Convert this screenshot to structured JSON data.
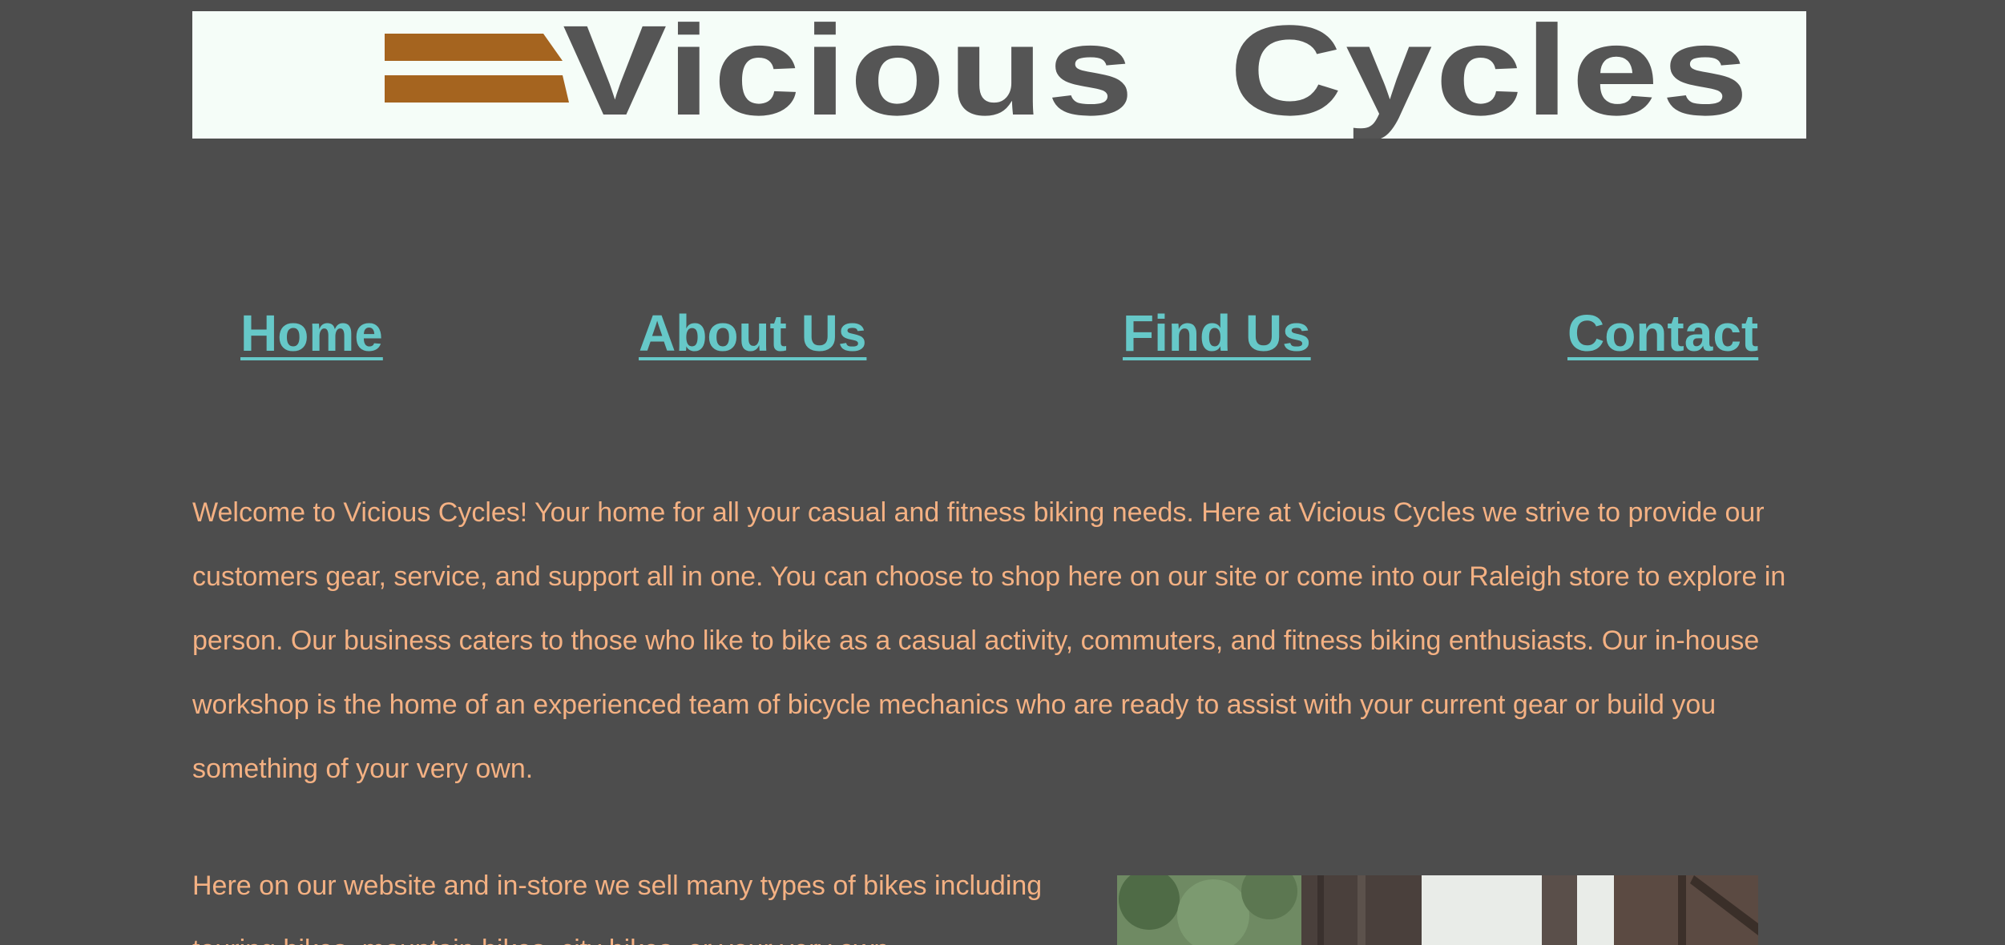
{
  "site": {
    "logo_text": "Vicious  Cycles",
    "colors": {
      "background": "#4d4d4d",
      "banner_bg": "#f5fdf8",
      "logo_stripe": "#a5641f",
      "logo_text": "#555555",
      "nav_link": "#66c8c8",
      "body_text": "#f4b183"
    }
  },
  "nav": {
    "items": [
      {
        "label": "Home"
      },
      {
        "label": "About Us"
      },
      {
        "label": "Find Us"
      },
      {
        "label": "Contact"
      }
    ]
  },
  "main": {
    "intro": "Welcome to Vicious Cycles! Your home for all your casual and fitness biking needs. Here at Vicious Cycles we strive to provide our customers gear, service, and support all in one. You can choose to shop here on our site or come into our Raleigh store to explore in person. Our business caters to those who like to bike as a casual activity, commuters, and fitness biking enthusiasts. Our in-house workshop is the home of an experienced team of bicycle mechanics who are ready to assist with your current gear or build you something of your very own.",
    "bikes_paragraph": "Here on our website and in-store we sell many types of bikes including touring bikes, mountain bikes, city bikes, or your very own"
  }
}
